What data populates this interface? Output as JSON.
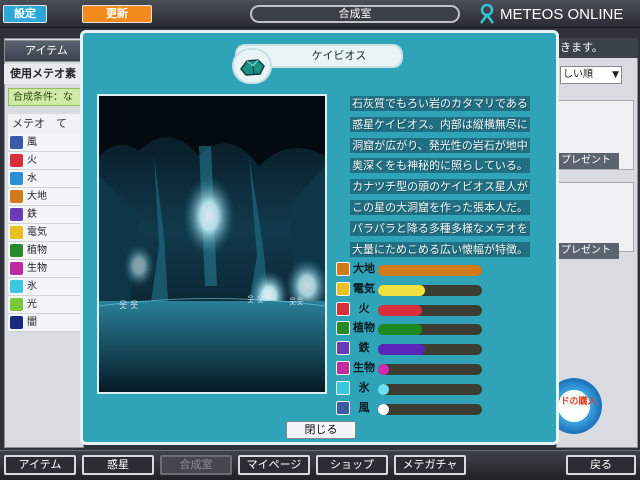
{
  "header": {
    "settings_label": "設定",
    "update_label": "更新",
    "screen_title": "合成室",
    "logo_text": "METEOS ONLINE"
  },
  "background": {
    "left_tab_label": "アイテム",
    "used_meteos_label": "使用メテオ素",
    "condition_label": "合成条件：な",
    "list_header": "メテオ　て",
    "meteor_list": [
      {
        "name": "風",
        "color": "#3a5aa8"
      },
      {
        "name": "火",
        "color": "#d8303a"
      },
      {
        "name": "水",
        "color": "#2a8fd8"
      },
      {
        "name": "大地",
        "color": "#d07a1a"
      },
      {
        "name": "鉄",
        "color": "#6a3ab8"
      },
      {
        "name": "電気",
        "color": "#e8c020"
      },
      {
        "name": "植物",
        "color": "#2a8a2a"
      },
      {
        "name": "生物",
        "color": "#c02aa0"
      },
      {
        "name": "氷",
        "color": "#38c8e0"
      },
      {
        "name": "光",
        "color": "#7ac83a"
      },
      {
        "name": "闇",
        "color": "#1a2a7a"
      }
    ],
    "right_header_text": "きます。",
    "sort_select_value": "しい順",
    "present_label": "プレゼント",
    "present_label_2": "プレゼント",
    "buy_badge_text": "ンドの購入"
  },
  "modal": {
    "meteor_name": "ケイビオス",
    "description_lines": [
      "石灰質でもろい岩のカタマリである",
      "惑星ケイビオス。内部は縦横無尽に",
      "洞窟が広がり、発光性の岩石が地中",
      "奥深くをも神秘的に照らしている。",
      "カナツチ型の頭のケイビオス星人が",
      "この星の大洞窟を作った張本人だ。",
      "パラパラと降る多種多様なメテオを",
      "大量にためこめる広い懐幅が特徴。"
    ],
    "stats": [
      {
        "label": "大地",
        "value": 1.0,
        "color": "#d07a1a",
        "icon_color": "#d07a1a"
      },
      {
        "label": "電気",
        "value": 0.45,
        "color": "#f0e040",
        "icon_color": "#e8c020"
      },
      {
        "label": "火",
        "value": 0.42,
        "color": "#d8303a",
        "icon_color": "#d8303a"
      },
      {
        "label": "植物",
        "value": 0.42,
        "color": "#1e8a1e",
        "icon_color": "#2a8a2a"
      },
      {
        "label": "鉄",
        "value": 0.45,
        "color": "#5a24b8",
        "icon_color": "#6a3ab8"
      },
      {
        "label": "生物",
        "value": 0.05,
        "color": "#d02ab0",
        "icon_color": "#c02aa0"
      },
      {
        "label": "氷",
        "value": 0.03,
        "color": "#6ae0f0",
        "icon_color": "#38c8e0"
      },
      {
        "label": "風",
        "value": 0.03,
        "color": "#ffffff",
        "icon_color": "#3a5aa8"
      }
    ],
    "close_label": "閉じる"
  },
  "bottom_nav": [
    {
      "label": "アイテム",
      "disabled": false
    },
    {
      "label": "惑星",
      "disabled": false
    },
    {
      "label": "合成室",
      "disabled": true
    },
    {
      "label": "マイページ",
      "disabled": false
    },
    {
      "label": "ショップ",
      "disabled": false
    },
    {
      "label": "メテガチャ",
      "disabled": false
    },
    {
      "label": "戻る",
      "disabled": false
    }
  ]
}
